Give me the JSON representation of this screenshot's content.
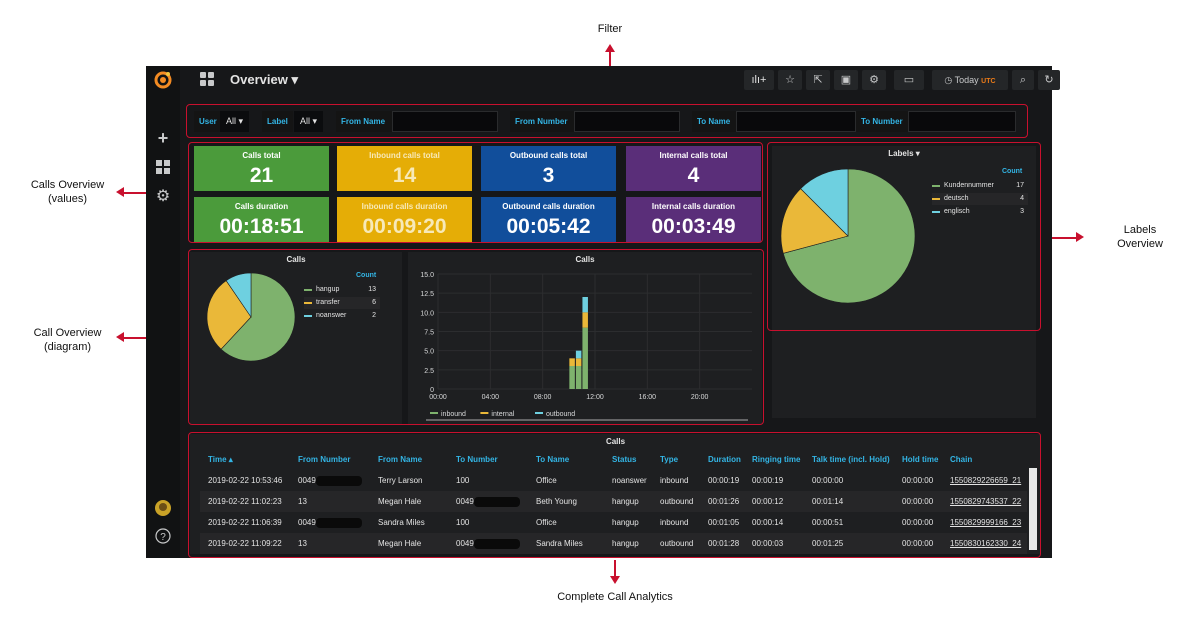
{
  "annotations": {
    "filter": "Filter",
    "calls_overview": "Calls Overview\n(values)",
    "call_overview_diagram": "Call Overview\n(diagram)",
    "labels_overview": "Labels\nOverview",
    "complete_call_analytics": "Complete Call Analytics"
  },
  "header": {
    "title": "Overview",
    "today_label": "Today",
    "tz_label": "UTC"
  },
  "icons": {
    "logo": "grafana-logo-icon",
    "add": "plus-icon",
    "dashboards": "dashboards-icon",
    "settings": "gear-icon",
    "avatar": "user-avatar-icon",
    "help": "help-icon",
    "add_panel": "add-panel-icon",
    "star": "star-icon",
    "share": "share-icon",
    "save": "save-icon",
    "dash_settings": "dashboard-settings-icon",
    "tv": "tv-mode-icon",
    "clock": "clock-icon",
    "zoom": "zoom-out-icon",
    "refresh": "refresh-icon"
  },
  "filters": {
    "user_label": "User",
    "user_value": "All",
    "label_label": "Label",
    "label_value": "All",
    "from_name": "From Name",
    "from_number": "From Number",
    "to_name": "To Name",
    "to_number": "To Number"
  },
  "stats": [
    {
      "title": "Calls total",
      "value": "21"
    },
    {
      "title": "Inbound calls total",
      "value": "14"
    },
    {
      "title": "Outbound calls total",
      "value": "3"
    },
    {
      "title": "Internal calls total",
      "value": "4"
    },
    {
      "title": "Calls duration",
      "value": "00:18:51"
    },
    {
      "title": "Inbound calls duration",
      "value": "00:09:20"
    },
    {
      "title": "Outbound calls duration",
      "value": "00:05:42"
    },
    {
      "title": "Internal calls duration",
      "value": "00:03:49"
    }
  ],
  "colors": {
    "green": "#7eb26d",
    "yellow": "#eab839",
    "cyan": "#6ed0e0",
    "accent": "#33b5e5",
    "highlight": "#c8102e"
  },
  "chart_data": [
    {
      "type": "pie",
      "title": "Calls",
      "legend_header": "Count",
      "legend_position": "right",
      "labels": [
        "hangup",
        "transfer",
        "noanswer"
      ],
      "values": [
        13,
        6,
        2
      ]
    },
    {
      "type": "bar",
      "title": "Calls",
      "stacked": true,
      "x": [
        "00:00",
        "04:00",
        "08:00",
        "12:00",
        "16:00",
        "20:00"
      ],
      "ylim": [
        0,
        15
      ],
      "yticks": [
        "15.0",
        "12.5",
        "10.0",
        "7.5",
        "5.0",
        "2.5",
        "0"
      ],
      "legend_position": "bottom",
      "bar_positions_hours": [
        10.25,
        10.75,
        11.25
      ],
      "series": [
        {
          "name": "inbound",
          "values": [
            3,
            3,
            8
          ]
        },
        {
          "name": "internal",
          "values": [
            1,
            1,
            2
          ]
        },
        {
          "name": "outbound",
          "values": [
            0,
            1,
            2
          ]
        }
      ]
    },
    {
      "type": "pie",
      "title": "Labels",
      "legend_header": "Count",
      "legend_position": "right",
      "labels": [
        "Kundennummer",
        "deutsch",
        "englisch"
      ],
      "values": [
        17,
        4,
        3
      ]
    }
  ],
  "table": {
    "title": "Calls",
    "columns": [
      "Time",
      "From Number",
      "From Name",
      "To Number",
      "To Name",
      "Status",
      "Type",
      "Duration",
      "Ringing time",
      "Talk time (incl. Hold)",
      "Hold time",
      "Chain"
    ],
    "rows": [
      [
        "2019-02-22 10:53:46",
        "0049",
        "Terry Larson",
        "100",
        "Office",
        "noanswer",
        "inbound",
        "00:00:19",
        "00:00:19",
        "00:00:00",
        "00:00:00",
        "1550829226659_21"
      ],
      [
        "2019-02-22 11:02:23",
        "13",
        "Megan Hale",
        "0049",
        "Beth Young",
        "hangup",
        "outbound",
        "00:01:26",
        "00:00:12",
        "00:01:14",
        "00:00:00",
        "1550829743537_22"
      ],
      [
        "2019-02-22 11:06:39",
        "0049",
        "Sandra Miles",
        "100",
        "Office",
        "hangup",
        "inbound",
        "00:01:05",
        "00:00:14",
        "00:00:51",
        "00:00:00",
        "1550829999166_23"
      ],
      [
        "2019-02-22 11:09:22",
        "13",
        "Megan Hale",
        "0049",
        "Sandra Miles",
        "hangup",
        "outbound",
        "00:01:28",
        "00:00:03",
        "00:01:25",
        "00:00:00",
        "1550830162330_24"
      ]
    ]
  }
}
